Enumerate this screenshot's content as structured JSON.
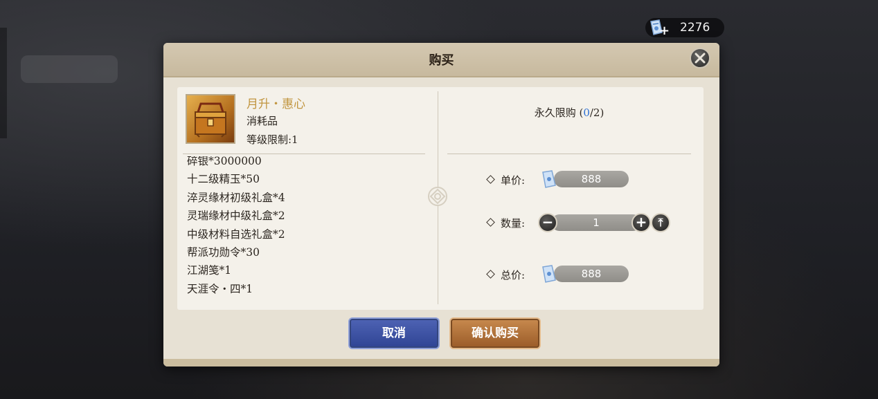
{
  "currency": {
    "icon": "ticket-currency-icon",
    "add_icon": "plus-icon",
    "amount": "2276"
  },
  "dialog": {
    "title": "购买",
    "item": {
      "name": "月升・惠心",
      "type": "消耗品",
      "level_limit": "等级限制:1",
      "icon": "treasure-chest-icon"
    },
    "contents": [
      "碎银*3000000",
      "十二级精玉*50",
      "淬灵缘材初级礼盒*4",
      "灵瑞缘材中级礼盒*2",
      "中级材料自选礼盒*2",
      "帮派功勋令*30",
      "江湖笺*1",
      "天涯令・四*1"
    ],
    "limit": {
      "label": "永久限购 (",
      "current": "0",
      "sep_max": "/2)"
    },
    "unit_price": {
      "label": "单价:",
      "value": "888"
    },
    "quantity": {
      "label": "数量:",
      "value": "1",
      "minus": "−",
      "plus": "+",
      "max": "⤒"
    },
    "total_price": {
      "label": "总价:",
      "value": "888"
    },
    "buttons": {
      "cancel": "取消",
      "confirm": "确认购买"
    }
  },
  "colors": {
    "item_name": "#c1953f",
    "limit_current": "#2b6fd3",
    "cancel_button": "#3d52a3",
    "confirm_button": "#b0703a"
  }
}
